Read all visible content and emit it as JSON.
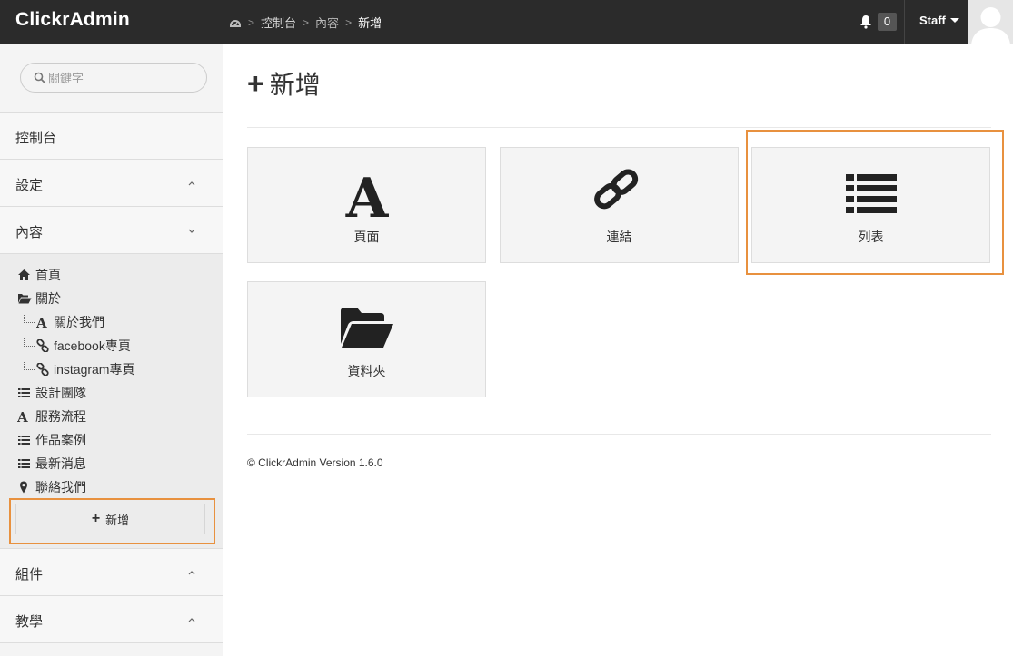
{
  "app": {
    "brand": "ClickrAdmin"
  },
  "breadcrumb": {
    "items": [
      "控制台",
      "內容",
      "新增"
    ]
  },
  "header": {
    "notification_count": "0",
    "user_label": "Staff"
  },
  "sidebar": {
    "search_placeholder": "關鍵字",
    "sections": [
      {
        "label": "控制台"
      },
      {
        "label": "設定"
      },
      {
        "label": "內容"
      }
    ],
    "tree": [
      {
        "label": "首頁",
        "icon": "home-icon"
      },
      {
        "label": "關於",
        "icon": "folder-open-icon"
      },
      {
        "label": "關於我們",
        "icon": "font-icon"
      },
      {
        "label": "facebook專頁",
        "icon": "link-icon"
      },
      {
        "label": "instagram專頁",
        "icon": "link-icon"
      },
      {
        "label": "設計團隊",
        "icon": "list-icon"
      },
      {
        "label": "服務流程",
        "icon": "font-icon"
      },
      {
        "label": "作品案例",
        "icon": "list-icon"
      },
      {
        "label": "最新消息",
        "icon": "list-icon"
      },
      {
        "label": "聯絡我們",
        "icon": "map-marker-icon"
      }
    ],
    "add_button": "新增",
    "bottom_sections": [
      {
        "label": "組件"
      },
      {
        "label": "教學"
      }
    ]
  },
  "main": {
    "title": "新增",
    "cards": [
      {
        "label": "頁面",
        "icon": "font-icon"
      },
      {
        "label": "連結",
        "icon": "link-icon"
      },
      {
        "label": "列表",
        "icon": "list-icon"
      },
      {
        "label": "資料夾",
        "icon": "folder-open-icon"
      }
    ],
    "footer": "© ClickrAdmin Version 1.6.0"
  },
  "colors": {
    "topbar": "#2b2b2b",
    "highlight": "#e8913f",
    "sidebar": "#f4f4f4"
  }
}
